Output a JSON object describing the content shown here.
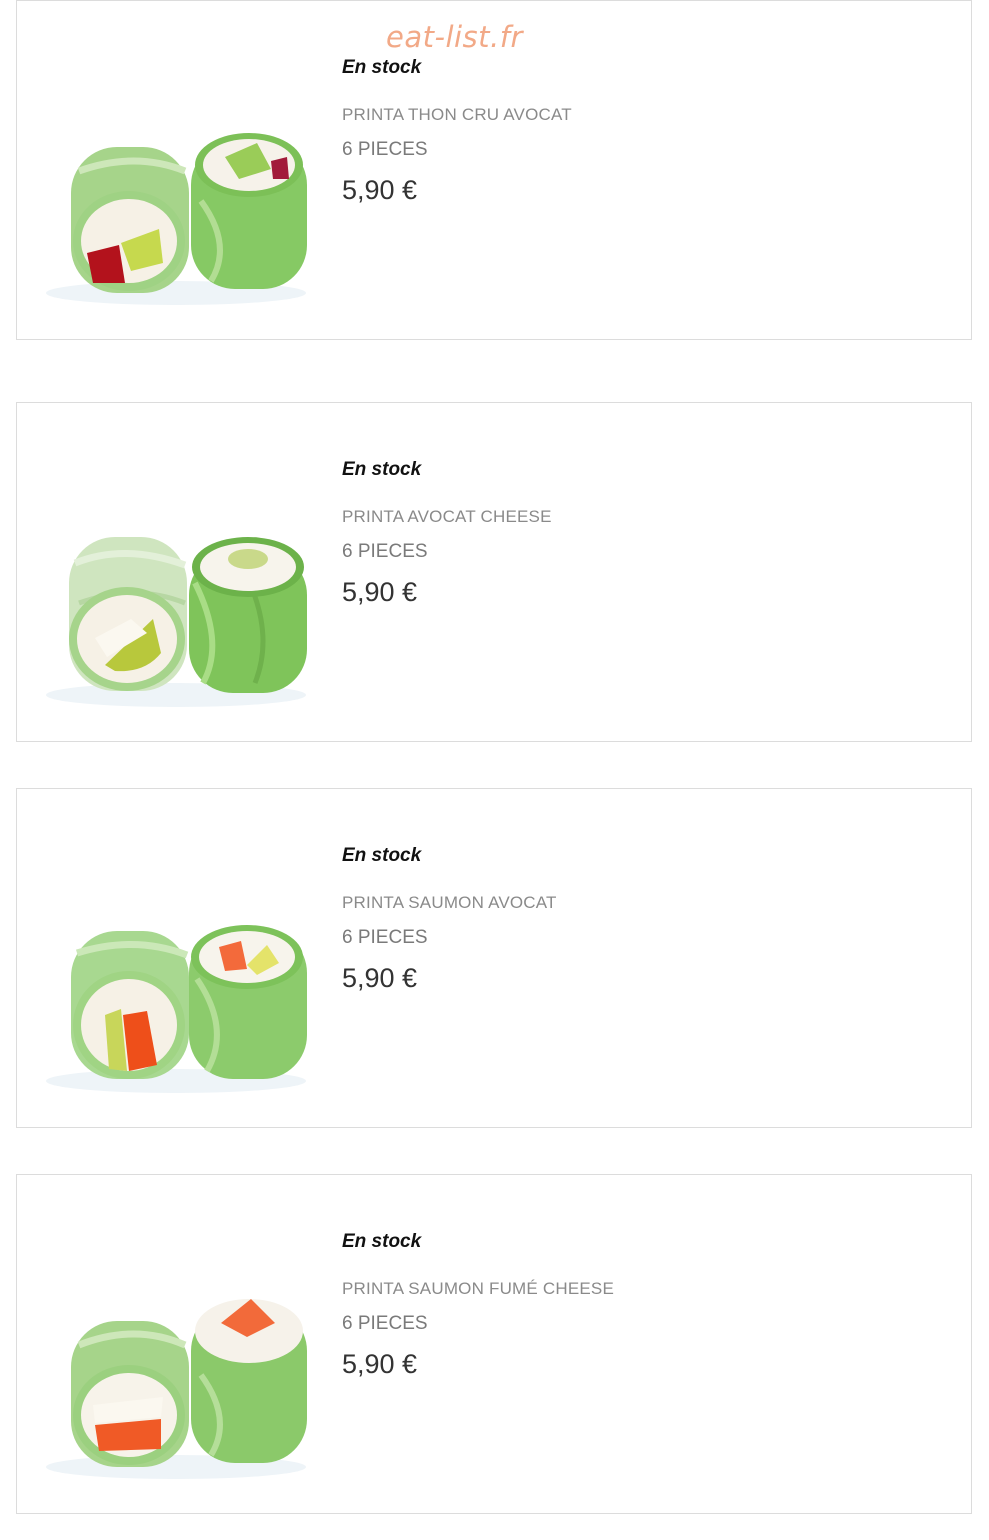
{
  "watermark": "eat-list.fr",
  "products": [
    {
      "stock": "En stock",
      "name": "PRINTA AVOCAT CHEESE",
      "pieces": "6 PIECES",
      "price": "5,90 €",
      "colors": {
        "left": "#fdf6ea",
        "right": "#8fd36a"
      }
    },
    {
      "stock": "En stock",
      "name": "PRINTA SAUMON AVOCAT",
      "pieces": "6 PIECES",
      "price": "5,90 €",
      "colors": {
        "left": "#e8541f",
        "right": "#8fd36a"
      }
    },
    {
      "stock": "En stock",
      "name": "PRINTA SAUMON FUMÉ CHEESE",
      "pieces": "6 PIECES",
      "price": "5,90 €",
      "colors": {
        "left": "#f26a3a",
        "right": "#f26a3a"
      }
    },
    {
      "stock": "En stock",
      "name": "PRINTA THON CRU AVOCAT",
      "pieces": "6 PIECES",
      "price": "5,90 €",
      "colors": {
        "left": "#b3121c",
        "right": "#8fd36a"
      }
    }
  ]
}
